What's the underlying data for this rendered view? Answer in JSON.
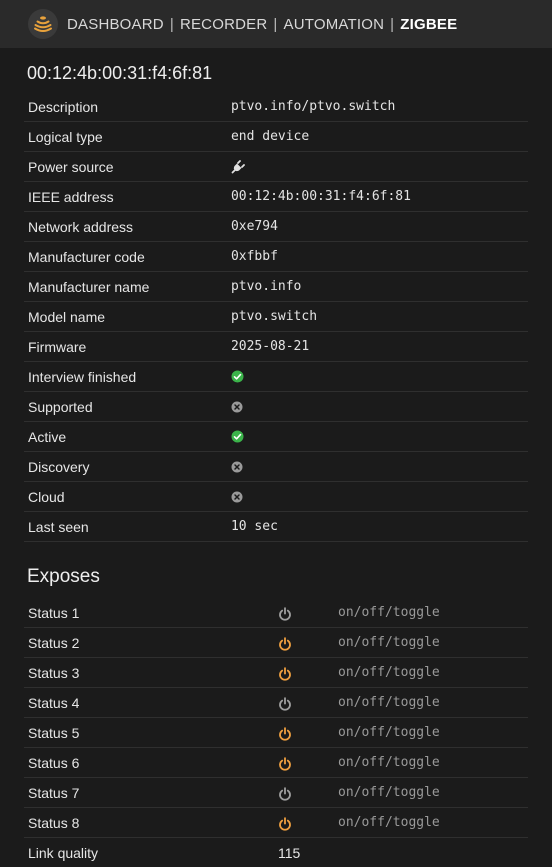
{
  "nav": {
    "items": [
      "DASHBOARD",
      "RECORDER",
      "AUTOMATION",
      "ZIGBEE"
    ],
    "separator": "|",
    "active": "ZIGBEE"
  },
  "device": {
    "title": "00:12:4b:00:31:f4:6f:81",
    "rows": [
      {
        "label": "Description",
        "value": "ptvo.info/ptvo.switch"
      },
      {
        "label": "Logical type",
        "value": "end device"
      },
      {
        "label": "Power source",
        "icon": "plug-icon"
      },
      {
        "label": "IEEE address",
        "value": "00:12:4b:00:31:f4:6f:81"
      },
      {
        "label": "Network address",
        "value": "0xe794"
      },
      {
        "label": "Manufacturer code",
        "value": "0xfbbf"
      },
      {
        "label": "Manufacturer name",
        "value": "ptvo.info"
      },
      {
        "label": "Model name",
        "value": "ptvo.switch"
      },
      {
        "label": "Firmware",
        "value": "2025-08-21"
      },
      {
        "label": "Interview finished",
        "icon": "check-circle-icon"
      },
      {
        "label": "Supported",
        "icon": "x-circle-icon"
      },
      {
        "label": "Active",
        "icon": "check-circle-icon"
      },
      {
        "label": "Discovery",
        "icon": "x-circle-icon"
      },
      {
        "label": "Cloud",
        "icon": "x-circle-icon"
      },
      {
        "label": "Last seen",
        "value": "10 sec"
      }
    ]
  },
  "exposes": {
    "title": "Exposes",
    "toggle_hint": "on/off/toggle",
    "statuses": [
      {
        "label": "Status 1",
        "state": "off"
      },
      {
        "label": "Status 2",
        "state": "on"
      },
      {
        "label": "Status 3",
        "state": "on"
      },
      {
        "label": "Status 4",
        "state": "off"
      },
      {
        "label": "Status 5",
        "state": "on"
      },
      {
        "label": "Status 6",
        "state": "on"
      },
      {
        "label": "Status 7",
        "state": "off"
      },
      {
        "label": "Status 8",
        "state": "on"
      }
    ],
    "link_quality": {
      "label": "Link quality",
      "value": "115"
    }
  },
  "colors": {
    "on": "#f0a040",
    "off": "#a0a0a0",
    "ok": "#3bb34a",
    "no": "#9a9a9a",
    "logo": "#e8a23c"
  }
}
